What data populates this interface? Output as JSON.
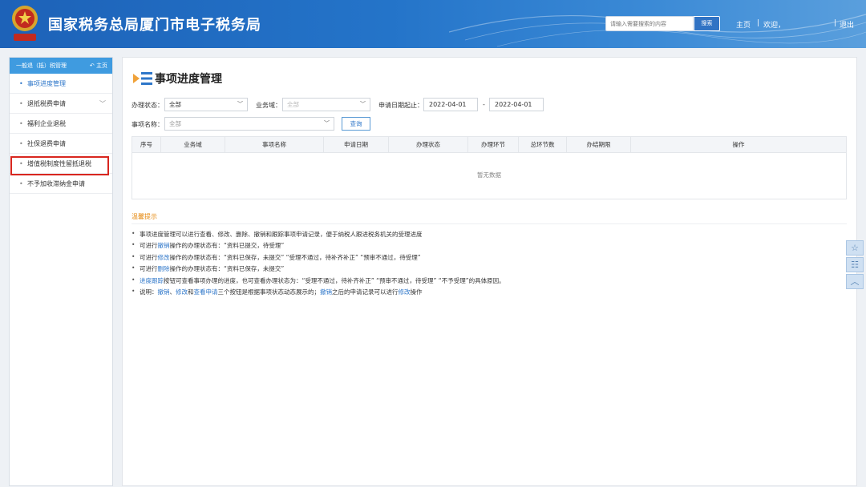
{
  "header": {
    "title": "国家税务总局厦门市电子税务局",
    "search_placeholder": "请输入需要搜索的内容",
    "search_button": "搜索",
    "home_link": "主页",
    "welcome": "欢迎，",
    "logout": "退出",
    "colors": {
      "bar_start": "#1d62b8",
      "bar_end": "#5a9fdd"
    }
  },
  "sidebar": {
    "heading": "一般退（抵）税管理",
    "home": "主页",
    "items": [
      {
        "label": "事项进度管理",
        "active": true
      },
      {
        "label": "退抵税费申请",
        "has_submenu": true
      },
      {
        "label": "福利企业退税"
      },
      {
        "label": "社保退费申请"
      },
      {
        "label": "增值税制度性留抵退税",
        "highlighted": true
      },
      {
        "label": "不予加收滞纳金申请"
      }
    ]
  },
  "main": {
    "title": "事项进度管理",
    "filters": {
      "status_label": "办理状态：",
      "status_value": "全部",
      "domain_label": "业务域：",
      "domain_value": "全部",
      "date_label": "申请日期起止：",
      "date_from": "2022-04-01",
      "date_sep": "-",
      "date_to": "2022-04-01",
      "item_label": "事项名称：",
      "item_value": "全部",
      "query_button": "查询"
    },
    "table": {
      "columns": [
        "序号",
        "业务域",
        "事项名称",
        "申请日期",
        "办理状态",
        "办理环节",
        "总环节数",
        "办结期限",
        "操作"
      ],
      "empty_text": "暂无数据"
    },
    "tips": {
      "title": "温馨提示",
      "lines": [
        [
          {
            "t": "事项进度管理可以进行查看、修改、删除、撤销和跟踪事项申请记录，便于纳税人跟进税务机关的受理进度"
          }
        ],
        [
          {
            "t": "可进行"
          },
          {
            "t": "撤销",
            "kw": true
          },
          {
            "t": "操作的办理状态有：“资料已提交，待受理”"
          }
        ],
        [
          {
            "t": "可进行"
          },
          {
            "t": "修改",
            "kw": true
          },
          {
            "t": "操作的办理状态有：“资料已保存，未提交”  “受理不通过，待补齐补正”  “预审不通过，待受理”"
          }
        ],
        [
          {
            "t": "可进行"
          },
          {
            "t": "删除",
            "kw": true
          },
          {
            "t": "操作的办理状态有：“资料已保存，未提交”"
          }
        ],
        [
          {
            "t": "进度跟踪",
            "kw": true
          },
          {
            "t": "按钮可查看事项办理的进度，也可查看办理状态为：“受理不通过，待补齐补正”  “预审不通过，待受理”  “不予受理”的具体原因。"
          }
        ],
        [
          {
            "t": "说明："
          },
          {
            "t": "撤销",
            "kw": true
          },
          {
            "t": "、"
          },
          {
            "t": "修改",
            "kw": true
          },
          {
            "t": "和"
          },
          {
            "t": "查看申请",
            "kw": true
          },
          {
            "t": "三个按钮是根据事项状态动态展示的；"
          },
          {
            "t": "撤销",
            "kw": true
          },
          {
            "t": "之后的申请记录可以进行"
          },
          {
            "t": "修改",
            "kw": true
          },
          {
            "t": "操作"
          }
        ]
      ]
    }
  },
  "floating": [
    "star-icon",
    "form-icon",
    "chevron-up-icon"
  ]
}
